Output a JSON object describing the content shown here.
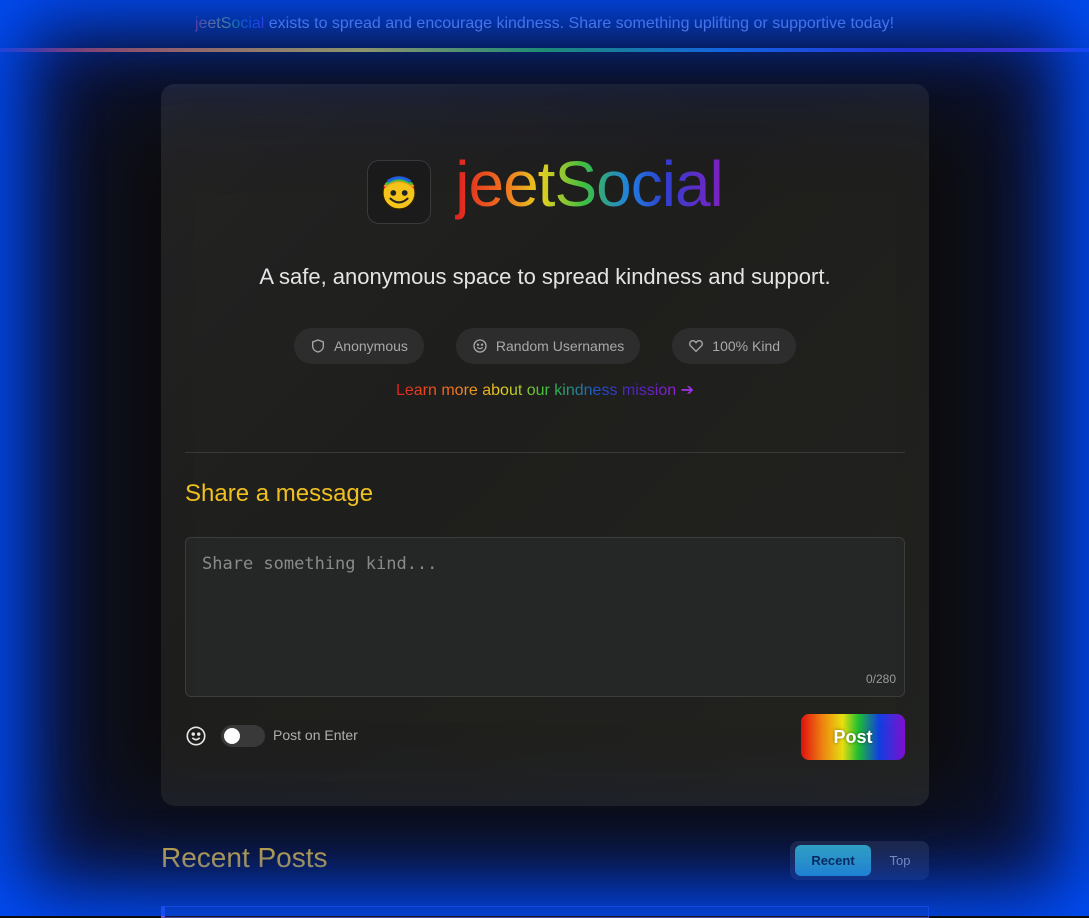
{
  "banner": {
    "brand": "jeetSocial",
    "text": " exists to spread and encourage kindness. Share something uplifting or supportive today!"
  },
  "header": {
    "brand": "jeetSocial",
    "tagline": "A safe, anonymous space to spread kindness and support."
  },
  "features": [
    {
      "icon": "shield-icon",
      "label": "Anonymous"
    },
    {
      "icon": "smiley-icon",
      "label": "Random Usernames"
    },
    {
      "icon": "heart-icon",
      "label": "100% Kind"
    }
  ],
  "learn_more": {
    "label": "Learn more about our kindness mission",
    "arrow": "➔"
  },
  "composer": {
    "title": "Share a message",
    "placeholder": "Share something kind...",
    "value": "",
    "counter": "0/280",
    "toggle_label": "Post on Enter",
    "toggle_on": false,
    "post_label": "Post"
  },
  "feed": {
    "title": "Recent Posts",
    "tabs": [
      {
        "label": "Recent",
        "active": true
      },
      {
        "label": "Top",
        "active": false
      }
    ]
  },
  "colors": {
    "accent_gold": "#f0c020",
    "tab_active": "#3ebfbf",
    "edge_glow": "#0050ff"
  }
}
